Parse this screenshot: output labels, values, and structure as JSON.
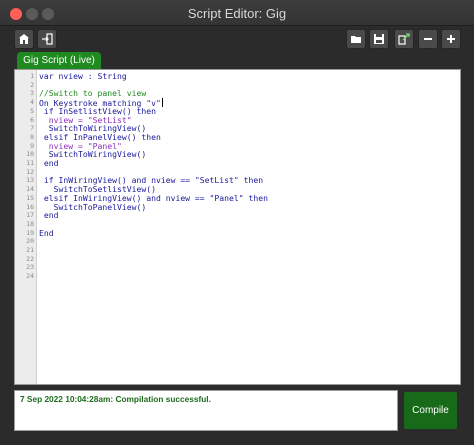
{
  "window": {
    "title": "Script Editor:  Gig"
  },
  "toolbar": {
    "left_icons": [
      "home-export-icon",
      "import-icon"
    ],
    "right_icons": [
      "folder-icon",
      "save-icon",
      "export-icon",
      "minus-icon",
      "plus-icon"
    ]
  },
  "tab": {
    "label": "Gig Script (Live)"
  },
  "editor": {
    "line_numbers": [
      "1",
      "2",
      "3",
      "4",
      "5",
      "6",
      "7",
      "8",
      "9",
      "10",
      "11",
      "12",
      "13",
      "14",
      "15",
      "16",
      "17",
      "18",
      "19",
      "20",
      "21",
      "22",
      "23",
      "24"
    ],
    "lines": [
      "var nview : String",
      "",
      "//Switch to panel view",
      "On Keystroke matching \"v\"",
      " if InSetlistView() then",
      "  nview = \"SetList\"",
      "  SwitchToWiringView()",
      " elsif InPanelView() then",
      "  nview = \"Panel\"",
      "  SwitchToWiringView()",
      " end",
      "",
      " if InWiringView() and nview == \"SetList\" then",
      "   SwitchToSetlistView()",
      " elsif InWiringView() and nview == \"Panel\" then",
      "   SwitchToPanelView()",
      " end",
      "",
      "End",
      "",
      "",
      "",
      "",
      ""
    ]
  },
  "status": {
    "message": "7 Sep 2022 10:04:28am: Compilation successful."
  },
  "actions": {
    "compile_label": "Compile"
  },
  "colors": {
    "tab_accent": "#1f8a1f",
    "compile_button": "#176a17",
    "status_text": "#1d6b1d",
    "keyword": "#1a1a9c",
    "comment": "#228a22",
    "string": "#8c2fb5"
  }
}
